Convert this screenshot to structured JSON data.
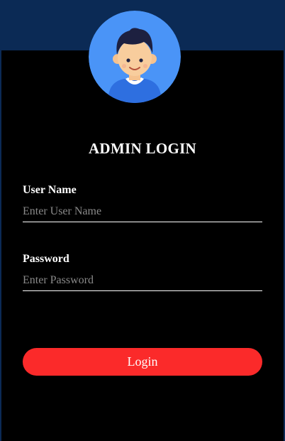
{
  "header": {
    "title": "ADMIN LOGIN"
  },
  "form": {
    "username_label": "User Name",
    "username_placeholder": "Enter User Name",
    "password_label": "Password",
    "password_placeholder": "Enter Password",
    "login_label": "Login"
  },
  "colors": {
    "background": "#0b2a55",
    "card": "#000000",
    "button": "#fb2a2a",
    "avatar_bg": "#4a94f7"
  },
  "icons": {
    "avatar": "user-avatar-icon"
  }
}
